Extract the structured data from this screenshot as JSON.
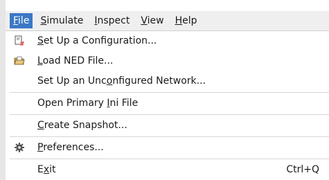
{
  "menubar": {
    "items": [
      {
        "label": "File",
        "mnemonic_index": 0,
        "active": true
      },
      {
        "label": "Simulate",
        "mnemonic_index": 0
      },
      {
        "label": "Inspect",
        "mnemonic_index": 0
      },
      {
        "label": "View",
        "mnemonic_index": 0
      },
      {
        "label": "Help",
        "mnemonic_index": 0
      }
    ]
  },
  "file_menu": {
    "items": [
      {
        "label": "Set Up a Configuration...",
        "mnemonic_index": 0,
        "icon": "configuration-icon"
      },
      {
        "label": "Load NED File...",
        "mnemonic_index": 0,
        "icon": "folder-open-icon"
      },
      {
        "label": "Set Up an Unconfigured Network...",
        "mnemonic_index": 13,
        "icon": null
      },
      {
        "separator": true
      },
      {
        "label": "Open Primary Ini File",
        "mnemonic_index": 13,
        "icon": null
      },
      {
        "separator": true
      },
      {
        "label": "Create Snapshot...",
        "mnemonic_index": 0,
        "icon": null
      },
      {
        "separator": true
      },
      {
        "label": "Preferences...",
        "mnemonic_index": 0,
        "icon": "gear-icon"
      },
      {
        "separator": true
      },
      {
        "label": "Exit",
        "mnemonic_index": 1,
        "icon": null,
        "shortcut": "Ctrl+Q"
      }
    ]
  },
  "colors": {
    "accent": "#3b78c6",
    "menubar_bg": "#efefef"
  }
}
